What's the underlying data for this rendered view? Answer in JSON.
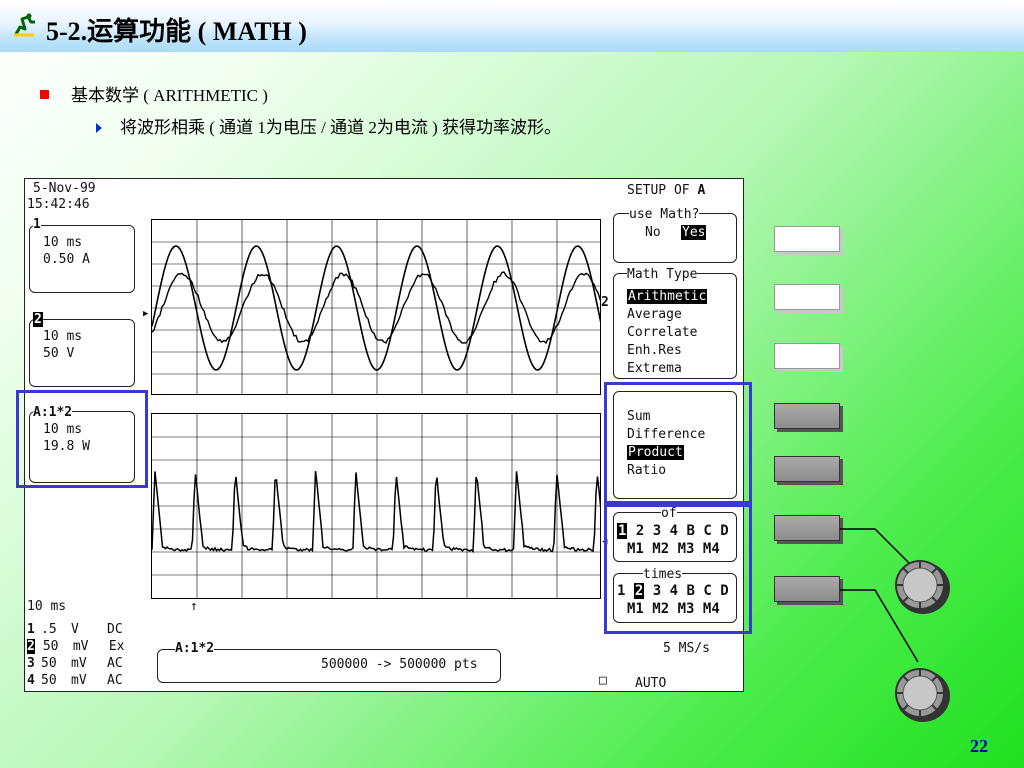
{
  "slide": {
    "title": "5-2.运算功能 ( MATH )",
    "bullet1": "基本数学 ( ARITHMETIC )",
    "bullet2": "将波形相乘 ( 通道 1为电压 / 通道 2为电流 ) 获得功率波形。",
    "page_number": "22",
    "colors": {
      "bullet_square": "#ff0000",
      "highlight_border": "#3a3ad0",
      "page_number": "#0000aa"
    }
  },
  "scope": {
    "date": "5-Nov-99",
    "time": "15:42:46",
    "ch1": {
      "label": "1",
      "timebase": "10 ms",
      "scale": "0.50 A"
    },
    "ch2": {
      "label": "2",
      "timebase": "10 ms",
      "scale": "50 V"
    },
    "math": {
      "label": "A:1*2",
      "timebase": "10 ms",
      "scale": "19.8 W"
    },
    "timebase_bottom": "10 ms",
    "channel_rows": [
      {
        "ch": "1",
        "v": ".5",
        "u": "V",
        "c": "DC"
      },
      {
        "ch": "2",
        "v": "50",
        "u": "mV",
        "c": "Ex"
      },
      {
        "ch": "3",
        "v": "50",
        "u": "mV",
        "c": "AC"
      },
      {
        "ch": "4",
        "v": "50",
        "u": "mV",
        "c": "AC"
      }
    ],
    "math_box_label": "A:1*2",
    "points": "500000 -> 500000 pts",
    "sample_rate": "5 MS/s",
    "trigger_mode": "AUTO",
    "trace_marker_2": "2",
    "menu": {
      "header": "SETUP OF",
      "header_target": "A",
      "use_math_label": "use Math?",
      "use_math_no": "No",
      "use_math_yes": "Yes",
      "math_type_label": "Math Type",
      "math_types": [
        "Arithmetic",
        "Average",
        "Correlate",
        "Enh.Res",
        "Extrema"
      ],
      "ops": [
        "Sum",
        "Difference",
        "Product",
        "Ratio"
      ],
      "of_label": "of",
      "of_row1": [
        "1",
        "2",
        "3",
        "4",
        "B",
        "C",
        "D"
      ],
      "of_row2": [
        "M1",
        "M2",
        "M3",
        "M4"
      ],
      "times_label": "times",
      "times_row1": [
        "1",
        "2",
        "3",
        "4",
        "B",
        "C",
        "D"
      ],
      "times_row2": [
        "M1",
        "M2",
        "M3",
        "M4"
      ]
    }
  }
}
